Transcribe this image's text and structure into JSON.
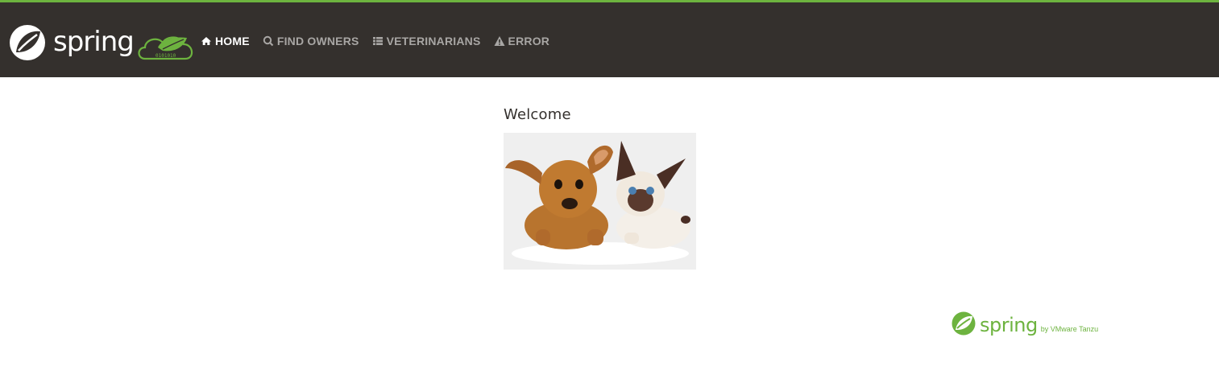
{
  "brand": {
    "logo_word": "spring",
    "badge_text": "0101010"
  },
  "nav": {
    "items": [
      {
        "label": "HOME",
        "icon": "home-icon",
        "active": true
      },
      {
        "label": "FIND OWNERS",
        "icon": "search-icon",
        "active": false
      },
      {
        "label": "VETERINARIANS",
        "icon": "list-icon",
        "active": false
      },
      {
        "label": "ERROR",
        "icon": "warning-icon",
        "active": false
      }
    ]
  },
  "main": {
    "title": "Welcome",
    "image": "pets-puppy-and-kitten"
  },
  "footer": {
    "logo_word": "spring",
    "sub_text": "by VMware Tanzu"
  },
  "colors": {
    "accent": "#6db33f",
    "navbar": "#34302d",
    "nav_text": "#a8a6a4",
    "nav_active": "#ffffff"
  }
}
